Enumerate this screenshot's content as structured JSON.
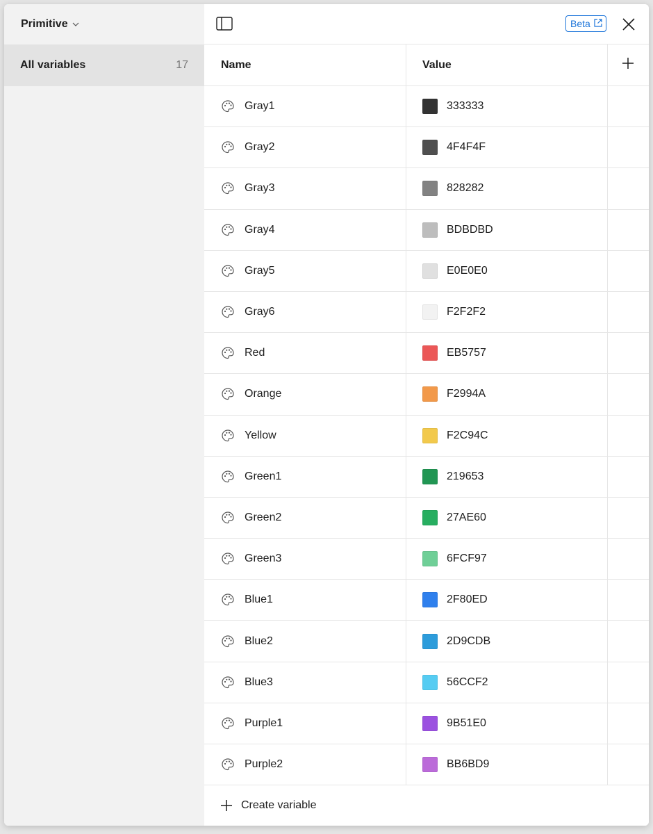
{
  "sidebar": {
    "collection": {
      "label": "Primitive",
      "icon": "chevron-down-icon"
    },
    "items": [
      {
        "label": "All variables",
        "count": "17",
        "selected": true
      }
    ]
  },
  "toolbar": {
    "panel_toggle_icon": "sidebar-toggle-icon",
    "beta_label": "Beta",
    "beta_icon": "external-link-icon",
    "close_icon": "close-icon"
  },
  "table": {
    "columns": [
      {
        "label": "Name"
      },
      {
        "label": "Value"
      }
    ],
    "add_column_icon": "plus-icon",
    "row_icon": "palette-icon",
    "rows": [
      {
        "name": "Gray1",
        "value": "333333",
        "color": "#333333"
      },
      {
        "name": "Gray2",
        "value": "4F4F4F",
        "color": "#4F4F4F"
      },
      {
        "name": "Gray3",
        "value": "828282",
        "color": "#828282"
      },
      {
        "name": "Gray4",
        "value": "BDBDBD",
        "color": "#BDBDBD"
      },
      {
        "name": "Gray5",
        "value": "E0E0E0",
        "color": "#E0E0E0"
      },
      {
        "name": "Gray6",
        "value": "F2F2F2",
        "color": "#F2F2F2"
      },
      {
        "name": "Red",
        "value": "EB5757",
        "color": "#EB5757"
      },
      {
        "name": "Orange",
        "value": "F2994A",
        "color": "#F2994A"
      },
      {
        "name": "Yellow",
        "value": "F2C94C",
        "color": "#F2C94C"
      },
      {
        "name": "Green1",
        "value": "219653",
        "color": "#219653"
      },
      {
        "name": "Green2",
        "value": "27AE60",
        "color": "#27AE60"
      },
      {
        "name": "Green3",
        "value": "6FCF97",
        "color": "#6FCF97"
      },
      {
        "name": "Blue1",
        "value": "2F80ED",
        "color": "#2F80ED"
      },
      {
        "name": "Blue2",
        "value": "2D9CDB",
        "color": "#2D9CDB"
      },
      {
        "name": "Blue3",
        "value": "56CCF2",
        "color": "#56CCF2"
      },
      {
        "name": "Purple1",
        "value": "9B51E0",
        "color": "#9B51E0"
      },
      {
        "name": "Purple2",
        "value": "BB6BD9",
        "color": "#BB6BD9"
      }
    ]
  },
  "footer": {
    "create_label": "Create variable",
    "create_icon": "plus-icon"
  },
  "colors": {
    "accent": "#1a73d9",
    "sidebar_bg": "#f2f2f2",
    "selected_bg": "#e3e3e3"
  }
}
